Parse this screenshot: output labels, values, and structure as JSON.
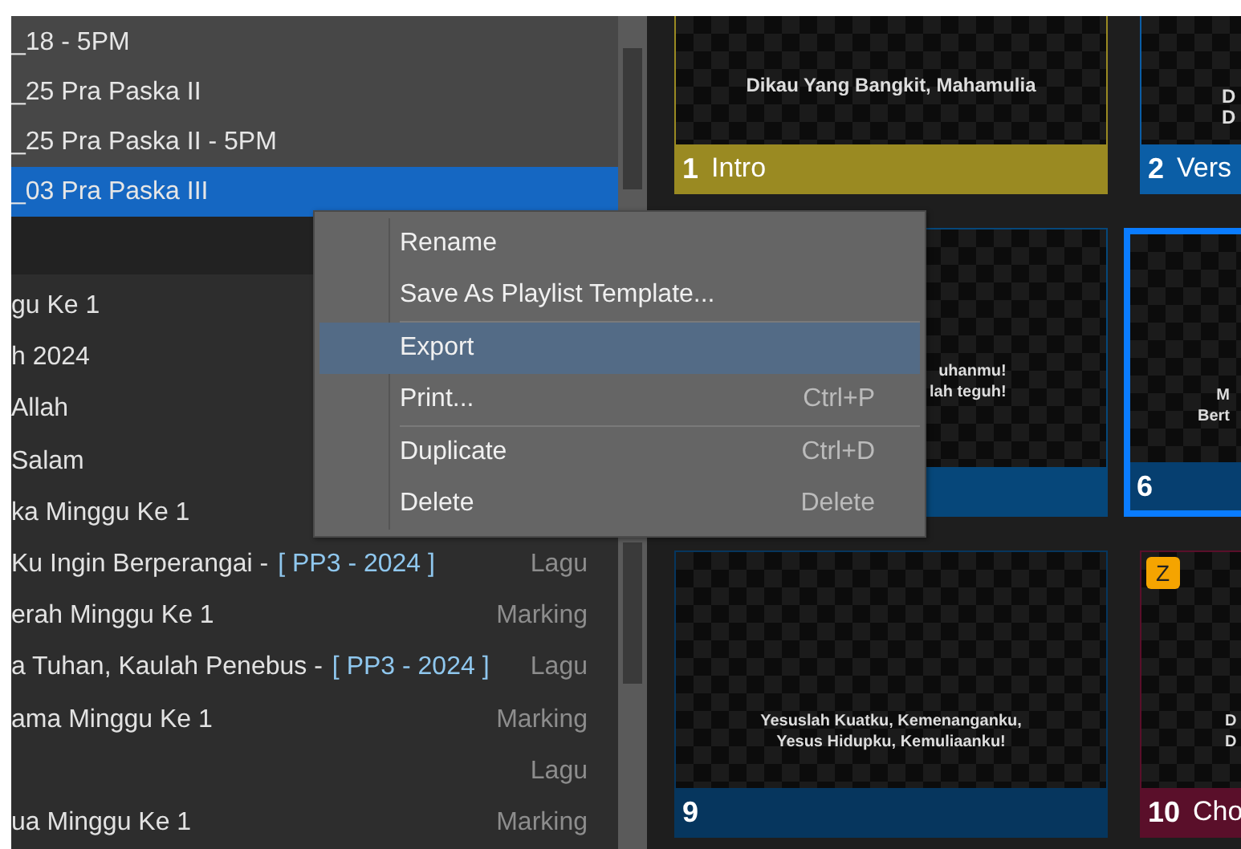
{
  "playlists": [
    {
      "name": "_18 - 5PM",
      "selected": false
    },
    {
      "name": "_25 Pra Paska II",
      "selected": false
    },
    {
      "name": "_25 Pra Paska II - 5PM",
      "selected": false
    },
    {
      "name": "_03 Pra Paska III",
      "selected": true
    }
  ],
  "items": [
    {
      "title": "gu Ke 1"
    },
    {
      "title": "h 2024"
    },
    {
      "title": "Allah"
    },
    {
      "title": "Salam"
    },
    {
      "title": "ka Minggu Ke 1"
    },
    {
      "title": "Ku Ingin Berperangai  -",
      "tag": "[ PP3 - 2024 ]",
      "type": "Lagu"
    },
    {
      "title": "erah Minggu Ke 1",
      "type": "Marking"
    },
    {
      "title": "a Tuhan, Kaulah Penebus  -",
      "tag": "[ PP3 - 2024 ]",
      "type": "Lagu"
    },
    {
      "title": "ama Minggu Ke 1",
      "type": "Marking"
    },
    {
      "type": "Lagu"
    },
    {
      "title": "ua Minggu Ke 1",
      "type": "Marking"
    }
  ],
  "slides": [
    {
      "number": "1",
      "label": "Intro",
      "color": "#9a8a22",
      "selected": false,
      "preview": [
        "Dikau Yang Bangkit, Mahamulia"
      ]
    },
    {
      "number": "2",
      "label": "Vers",
      "color": "#0b5ea6",
      "selected": false,
      "preview": [
        "D",
        "D"
      ]
    },
    {
      "color": "#06477a",
      "selected": false,
      "preview": [
        "uhanmu!",
        "lah teguh!"
      ]
    },
    {
      "number": "6",
      "color": "#063f70",
      "selected": true,
      "preview": [
        "M",
        "Bert"
      ]
    },
    {
      "number": "9",
      "color": "#06365e",
      "selected": false,
      "preview": [
        "Yesuslah Kuatku, Kemenanganku,",
        "Yesus Hidupku, Kemuliaanku!"
      ]
    },
    {
      "number": "10",
      "label": "Cho",
      "color": "#5a0f2a",
      "selected": false,
      "badge": "Z",
      "preview": [
        "D",
        "D"
      ]
    }
  ],
  "context_menu": [
    {
      "kind": "item",
      "label": "Rename",
      "selected": false
    },
    {
      "kind": "item",
      "label": "Save As Playlist Template...",
      "selected": false
    },
    {
      "kind": "separator"
    },
    {
      "kind": "item",
      "label": "Export",
      "selected": true
    },
    {
      "kind": "item",
      "label": "Print...",
      "shortcut": "Ctrl+P",
      "selected": false
    },
    {
      "kind": "separator"
    },
    {
      "kind": "item",
      "label": "Duplicate",
      "shortcut": "Ctrl+D",
      "selected": false
    },
    {
      "kind": "item",
      "label": "Delete",
      "shortcut": "Delete",
      "selected": false
    }
  ]
}
